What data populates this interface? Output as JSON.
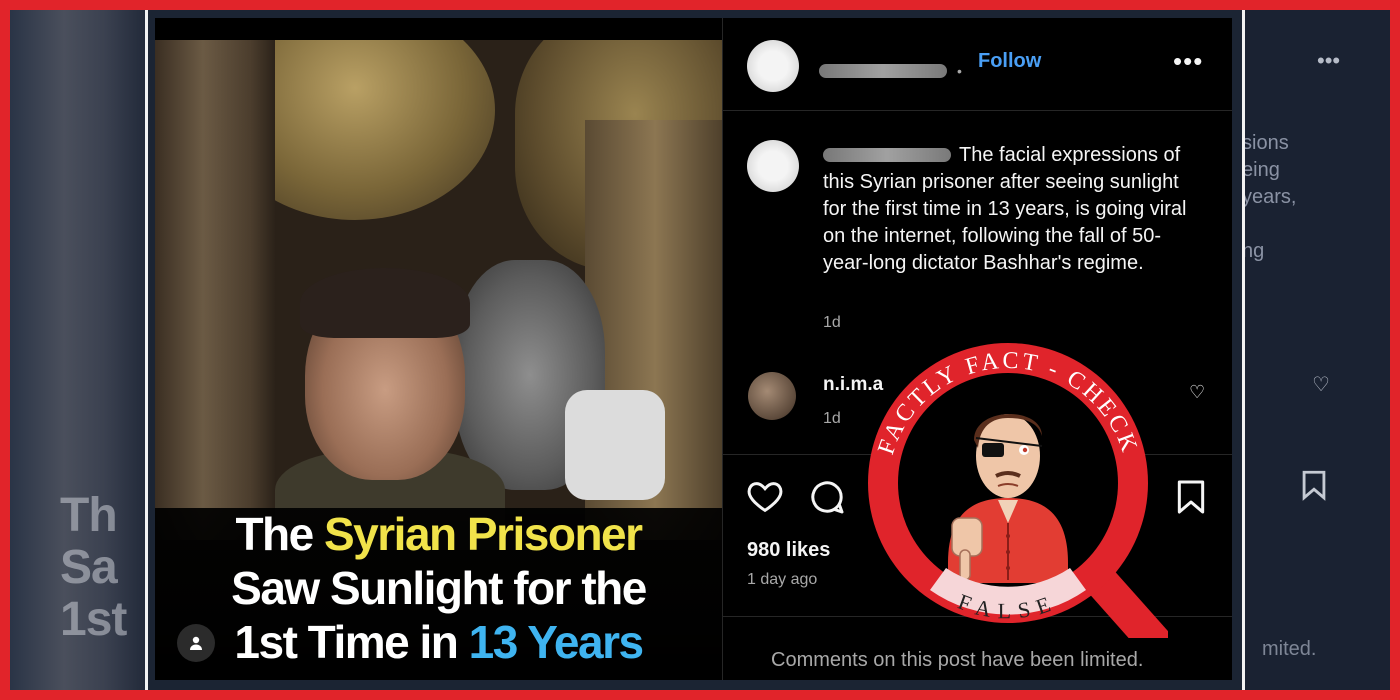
{
  "background": {
    "left_overlay_lines": [
      "Th",
      "Sa",
      "1st"
    ],
    "right_caption_fragments": [
      "sions",
      "eing",
      "years,",
      "",
      "ng"
    ],
    "right_more": "•••",
    "right_limited": "mited."
  },
  "media": {
    "caption_line1_a": "The ",
    "caption_line1_b": "Syrian Prisoner",
    "caption_line2": "Saw Sunlight for the",
    "caption_line3_a": "1st Time in ",
    "caption_line3_b": "13 Years",
    "person_icon": "person-icon"
  },
  "post": {
    "follow_label": "Follow",
    "more_label": "•••",
    "separator": "•",
    "caption": "The facial expressions of this Syrian prisoner after seeing sunlight for the first time in 13 years, is going viral on the internet, following the fall of 50-year-long dictator Bashhar's regime.",
    "caption_time": "1d",
    "comment_user": "n.i.m.a",
    "comment_emojis": "😢😢😢😢",
    "comment_time": "1d",
    "likes": "980 likes",
    "posted_ago": "1 day ago",
    "comments_limited": "Comments on this post have been limited."
  },
  "factcheck": {
    "ring_text": "FACTLY FACT - CHECK",
    "verdict": "FALSE"
  },
  "colors": {
    "frame_red": "#e1242a",
    "caption_yellow": "#f1e34a",
    "caption_blue": "#3fb4f0",
    "follow_blue": "#4a9ff5",
    "badge_red": "#e0242b"
  }
}
